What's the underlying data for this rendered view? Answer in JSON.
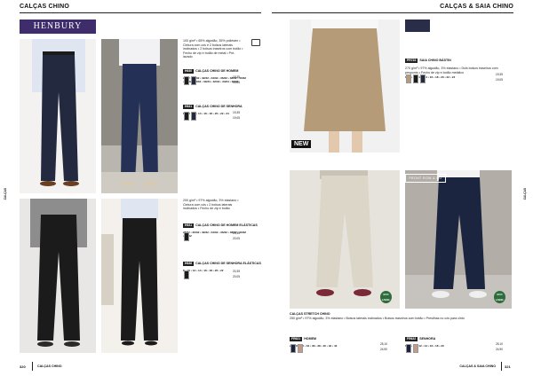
{
  "left_page": {
    "header": "CALÇAS CHINO",
    "brand_logo": "HENBURY",
    "side_tab": "CALÇAS",
    "page_number": "320",
    "footer_label": "CALÇAS CHINO",
    "block1": {
      "description": "100 g/m² • 65% algodão, 35% poliéster • Cintura com cós e 2 bolsos laterais inclinados • 2 bolsos traseiros com botão • Fecho de zip e botão de metal • Pré-lavado",
      "product1": {
        "code": "H640",
        "name": "CALÇAS CHINO DE HOMEM",
        "sizes": "28/32 • 30/32 • 32/32 • 34/32 • 36/32 • 38/32 • 40/32 • 42/32 • 44/32 • 30/34 • 32/34 • 34/34 • 36/34",
        "price_a": "19,35",
        "price_b": "19,05"
      },
      "product2": {
        "code": "H641",
        "name": "CALÇAS CHINO DE SENHORA",
        "sizes": "8 • 10 • 12 • 14 • 16 • 18 • 20 • 22 • 24",
        "price_a": "19,35",
        "price_b": "19,05"
      }
    },
    "block2": {
      "description": "200 g/m² • 97% algodão, 3% elastano • Cintura com cós • 2 bolsos laterais inclinados • Fecho de zip e botão",
      "product1": {
        "code": "H641",
        "name": "CALÇAS CHINO DE HOMEM ELÁSTICAS",
        "sizes": "28/32 • 30/32 • 32/32 • 34/32 • 36/32 • 38/32 • 40/32 • 42/32",
        "price_a": "20,35",
        "price_b": "20,05"
      },
      "product2": {
        "code": "H646",
        "name": "CALÇAS CHINO DE SENHORA ELÁSTICAS",
        "sizes": "8 • 10 • 12 • 14 • 16 • 18 • 20 • 22",
        "price_a": "20,35",
        "price_b": "20,05"
      }
    }
  },
  "right_page": {
    "header": "CALÇAS & SAIA CHINO",
    "side_tab": "CALÇAS",
    "page_number": "321",
    "footer_label": "CALÇAS & SAIA CHINO",
    "new_tag": "NEW",
    "brand_logo_2": "FRONT ROW & CO",
    "skirt": {
      "code": "PR722",
      "name": "SAIA CHINO BÁSTIN",
      "description": "270 g/m² • 97% algodão, 3% elastano • Dois bolsos traseiros com pesponto • Fecho de zip e botão metálico",
      "sizes": "6 • 8 • 10 • 12 • 14 • 16 • 18 • 20 • 22 • 24",
      "price_a": "19,35",
      "price_b": "19,05"
    },
    "chino": {
      "title": "CALÇAS STRETCH CHINO",
      "description": "250 g/m² • 97% algodão, 3% elastano • Bolsos laterais inclinados • Bolsos traseiros com botão • Presilhas no cós para cinto",
      "men": {
        "code": "FR621",
        "name": "HOMEM",
        "sizes": "28 • 30 • 32 • 34 • 36 • 38 • 40 • 42 • 44",
        "price_a": "25,10",
        "price_b": "24,90"
      },
      "women": {
        "code": "FR622",
        "name": "SENHORA",
        "sizes": "6 • 8 • 10 • 12 • 14 • 16 • 18 • 20",
        "price_a": "25,10",
        "price_b": "24,90"
      }
    },
    "eco_badge": "ECO LABEL"
  },
  "colors": {
    "henbury_purple": "#3f2d6b",
    "navy": "#1c2540",
    "khaki": "#b59b77",
    "stone": "#d8d3c6",
    "black": "#1b1b1b"
  }
}
